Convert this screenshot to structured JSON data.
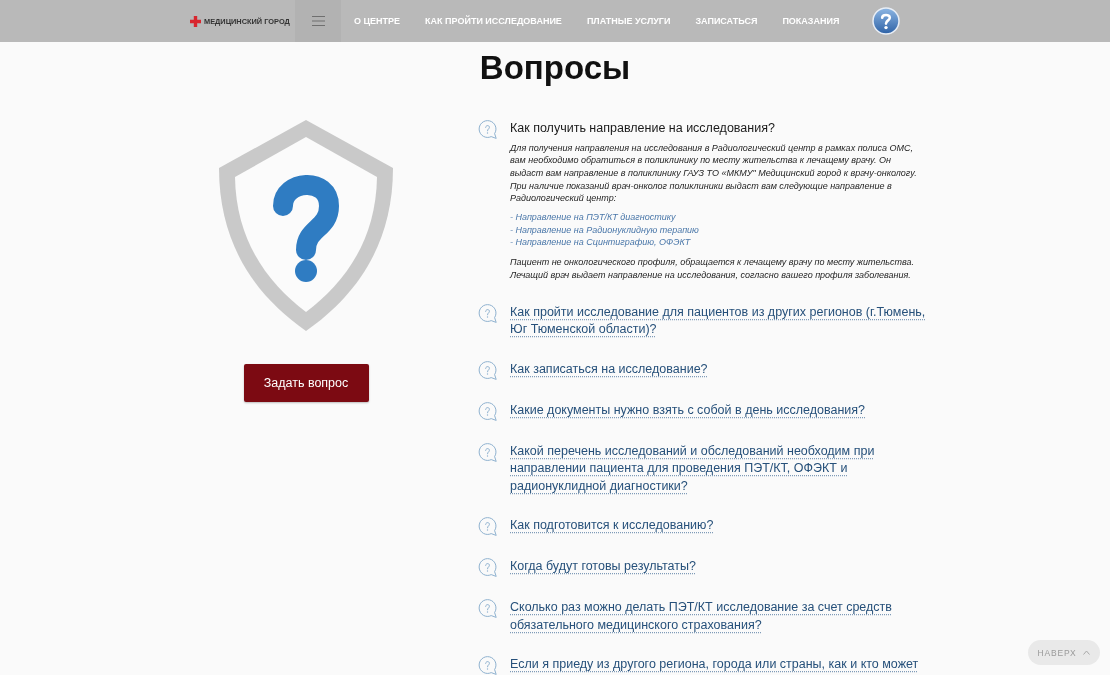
{
  "header": {
    "logo_text": "МЕДИЦИНСКИЙ ГОРОД",
    "nav": [
      "О ЦЕНТРЕ",
      "КАК ПРОЙТИ ИССЛЕДОВАНИЕ",
      "ПЛАТНЫЕ УСЛУГИ",
      "ЗАПИСАТЬСЯ",
      "ПОКАЗАНИЯ"
    ]
  },
  "title": "Вопросы",
  "ask_button": "Задать вопрос",
  "faq": [
    {
      "question": "Как получить направление на исследования?",
      "expanded": true,
      "answer": [
        {
          "kind": "paragraph",
          "text": "Для получения направления на исследования в Радиологический центр в рамках полиса ОМС, вам необходимо обратиться в поликлинику по месту жительства к лечащему врачу. Он выдаст вам направление в поликлинику ГАУЗ ТО «МКМУ\" Медицинский город к врачу-онкологу. При наличие показаний врач-онколог поликлиники выдаст вам следующие направление в Радиологический центр:"
        },
        {
          "kind": "links",
          "items": [
            "- Направление на ПЭТ/КТ диагностику",
            "- Направление на Радионуклидную терапию",
            "- Направление на Сцинтиграфию, ОФЭКТ"
          ]
        },
        {
          "kind": "paragraph",
          "text": "Пациент не онкологического профиля, обращается к лечащему врачу по месту жительства. Лечащий врач выдает направление на исследования, согласно вашего профиля заболевания."
        }
      ]
    },
    {
      "question": "Как пройти исследование для пациентов из других регионов (г.Тюмень, Юг Тюменской области)?",
      "expanded": false
    },
    {
      "question": "Как записаться на исследование?",
      "expanded": false
    },
    {
      "question": "Какие документы нужно взять с собой в день исследования?",
      "expanded": false
    },
    {
      "question": "Какой перечень исследований и обследований необходим при направлении пациента для проведения ПЭТ/КТ, ОФЭКТ и радионуклидной диагностики?",
      "expanded": false
    },
    {
      "question": "Как подготовится к исследованию?",
      "expanded": false
    },
    {
      "question": "Когда будут готовы результаты?",
      "expanded": false
    },
    {
      "question": "Сколько раз можно делать ПЭТ/КТ исследование за счет средств обязательного медицинского страхования?",
      "expanded": false
    },
    {
      "question": "Если я приеду из другого региона, города или страны, как и кто может",
      "expanded": false
    }
  ],
  "back_to_top": "НАВЕРХ"
}
